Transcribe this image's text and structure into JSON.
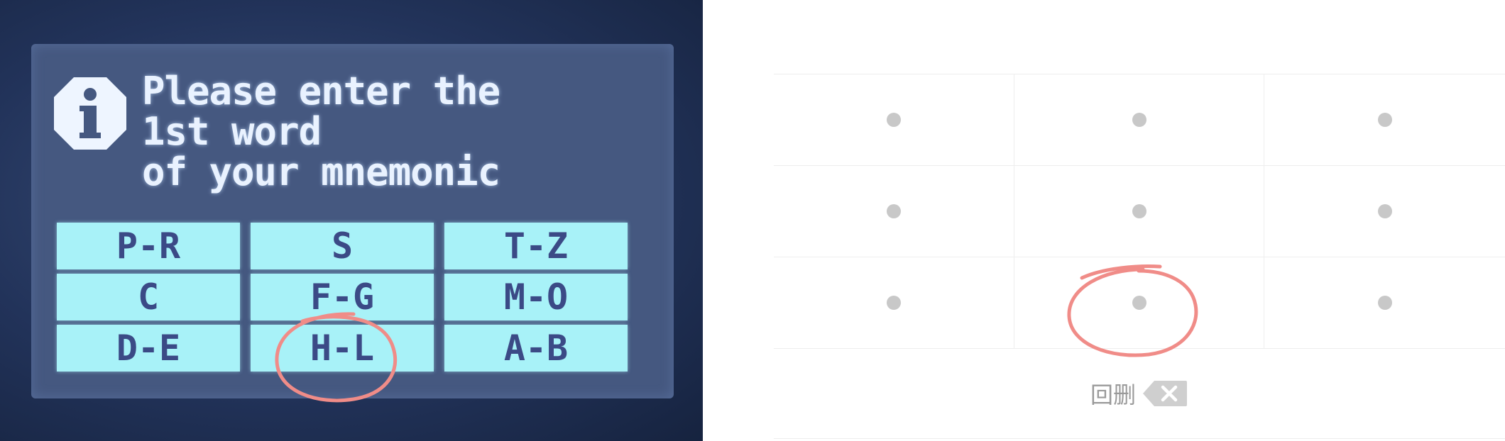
{
  "device": {
    "prompt_lines": [
      "Please enter the",
      "1st word",
      "of your mnemonic"
    ],
    "keys": [
      "P-R",
      "S",
      "T-Z",
      "C",
      "F-G",
      "M-O",
      "D-E",
      "H-L",
      "A-B"
    ],
    "circled_key": "H-L",
    "colors": {
      "screen": "#455880",
      "key_bg": "#a8f2f8",
      "key_text": "#3b4a86",
      "circle": "#f08c88"
    }
  },
  "pad": {
    "rows": 3,
    "cols": 3,
    "circled_position": "row 3, column 2",
    "delete_label": "回删",
    "delete_icon": "backspace-icon"
  }
}
